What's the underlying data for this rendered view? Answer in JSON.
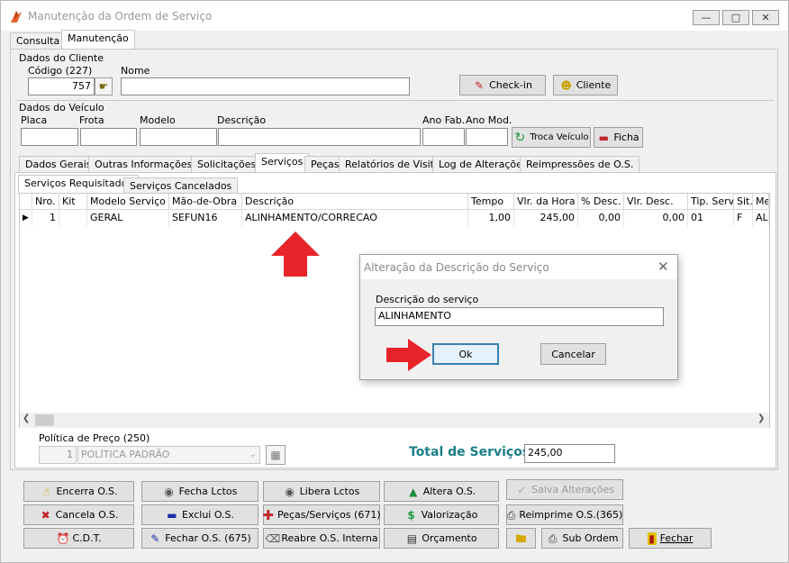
{
  "window": {
    "title": "Manutenção da Ordem de Serviço",
    "controls": [
      "minimize-icon",
      "restore-icon",
      "close-icon"
    ]
  },
  "main_tabs": [
    "Consulta",
    "Manutenção"
  ],
  "cliente": {
    "section": "Dados do Cliente",
    "codigo_label": "Código (227)",
    "codigo_value": "757",
    "nome_label": "Nome",
    "nome_value": "",
    "checkin_button": "Check-in",
    "cliente_button": "Cliente"
  },
  "veiculo": {
    "section": "Dados do Veículo",
    "placa_label": "Placa",
    "frota_label": "Frota",
    "modelo_label": "Modelo",
    "descricao_label": "Descrição",
    "anofab_label": "Ano Fab.",
    "anomod_label": "Ano Mod.",
    "troca_button": "Troca Veículo",
    "ficha_button": "Ficha"
  },
  "detail_tabs": [
    "Dados Gerais",
    "Outras Informações",
    "Solicitações",
    "Serviços",
    "Peças",
    "Relatórios de Visita",
    "Log de Alterações",
    "Reimpressões de O.S."
  ],
  "sub_tabs": [
    "Serviços Requisitados",
    "Serviços Cancelados"
  ],
  "grid": {
    "columns": [
      "Nro.",
      "Kit",
      "Modelo Serviço",
      "Mão-de-Obra",
      "Descrição",
      "Tempo",
      "Vlr. da Hora",
      "% Desc.",
      "Vlr. Desc.",
      "Tip. Serv.",
      "Sit.",
      "Me"
    ],
    "rows": [
      {
        "nro": "1",
        "kit": "",
        "modelo": "GERAL",
        "mao": "SEFUN16",
        "descricao": "ALINHAMENTO/CORRECAO",
        "tempo": "1,00",
        "vlr_hora": "245,00",
        "pct_desc": "0,00",
        "vlr_desc": "0,00",
        "tip": "01",
        "sit": "F",
        "me": "ALI"
      }
    ]
  },
  "politica": {
    "label": "Política de Preço (250)",
    "code": "1",
    "value": "POLÍTICA PADRÃO"
  },
  "total": {
    "label": "Total de Serviços",
    "value": "245,00"
  },
  "dialog": {
    "title": "Alteração da Descrição do Serviço",
    "field_label": "Descrição do serviço",
    "field_value": "ALINHAMENTO",
    "ok_button": "Ok",
    "cancel_button": "Cancelar"
  },
  "actions": {
    "encerra": "Encerra O.S.",
    "fecha_lctos": "Fecha Lctos",
    "libera_lctos": "Libera Lctos",
    "altera": "Altera O.S.",
    "salva": "Salva Alterações",
    "cancela": "Cancela O.S.",
    "exclui": "Exclui O.S.",
    "pecas_servicos": "Peças/Serviços (671)",
    "valorizacao": "Valorização",
    "reimprime": "Reimprime O.S.(365)",
    "cdt": "C.D.T.",
    "fechar_os": "Fechar O.S. (675)",
    "reabre": "Reabre O.S. Interna",
    "orcamento": "Orçamento",
    "sub_ordem": "Sub Ordem",
    "fechar": "Fechar"
  },
  "colors": {
    "total_label": "#1a7f86",
    "arrow": "#e8232a",
    "ok_border": "#3c7fb1"
  }
}
